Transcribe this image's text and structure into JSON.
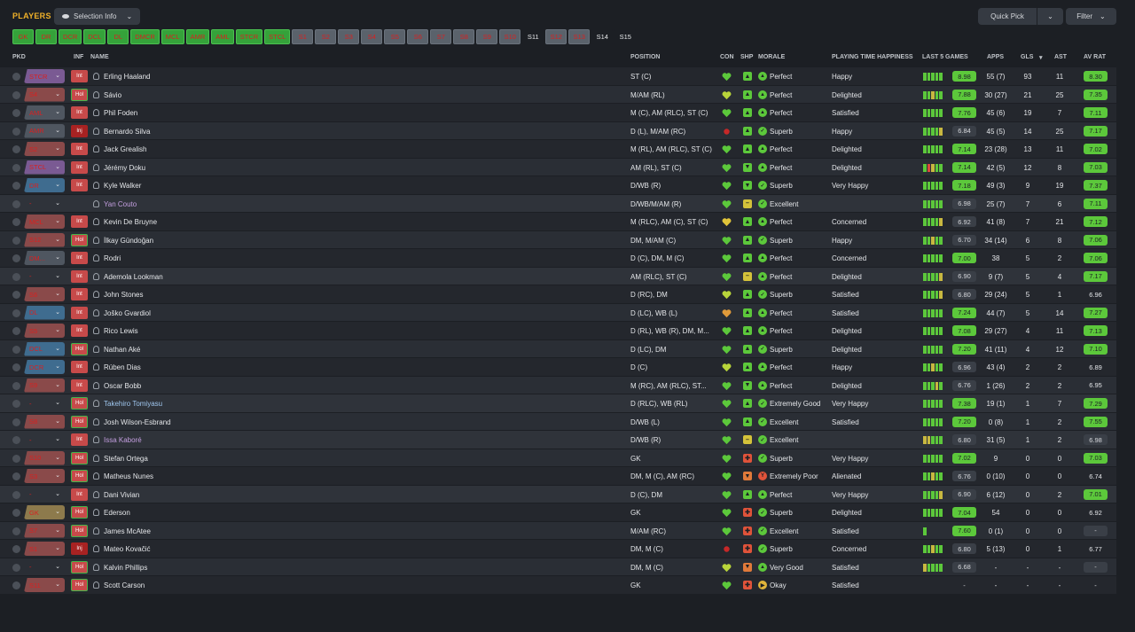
{
  "header": {
    "title": "PLAYERS",
    "selection_info": "Selection Info",
    "quick_pick": "Quick Pick",
    "filter": "Filter"
  },
  "chips": [
    {
      "label": "GK",
      "style": "green"
    },
    {
      "label": "DR",
      "style": "green"
    },
    {
      "label": "DCR",
      "style": "green"
    },
    {
      "label": "DCL",
      "style": "green"
    },
    {
      "label": "DL",
      "style": "green"
    },
    {
      "label": "DMCR",
      "style": "green"
    },
    {
      "label": "MCL",
      "style": "green"
    },
    {
      "label": "AMR",
      "style": "green"
    },
    {
      "label": "AML",
      "style": "green"
    },
    {
      "label": "STCR",
      "style": "green"
    },
    {
      "label": "STCL",
      "style": "green"
    },
    {
      "label": "S1",
      "style": "grey"
    },
    {
      "label": "S2",
      "style": "grey"
    },
    {
      "label": "S3",
      "style": "grey"
    },
    {
      "label": "S4",
      "style": "grey"
    },
    {
      "label": "S5",
      "style": "grey"
    },
    {
      "label": "S6",
      "style": "grey"
    },
    {
      "label": "S7",
      "style": "grey"
    },
    {
      "label": "S8",
      "style": "grey"
    },
    {
      "label": "S9",
      "style": "grey"
    },
    {
      "label": "S10",
      "style": "grey"
    },
    {
      "label": "S11",
      "style": "dark"
    },
    {
      "label": "S12",
      "style": "grey"
    },
    {
      "label": "S13",
      "style": "grey"
    },
    {
      "label": "S14",
      "style": "dark"
    },
    {
      "label": "S15",
      "style": "dark"
    }
  ],
  "columns": {
    "pkd": "PKD",
    "inf": "INF",
    "name": "NAME",
    "position": "POSITION",
    "con": "CON",
    "shp": "SHP",
    "morale": "MORALE",
    "pth": "PLAYING TIME HAPPINESS",
    "last5": "LAST 5 GAMES",
    "apps": "APPS",
    "gls": "GLS",
    "ast": "AST",
    "avrat": "AV RAT"
  },
  "colors": {
    "accent": "#f0b129",
    "good": "#5cc83b",
    "bad": "#d92020"
  },
  "players": [
    {
      "pkd": "STCR",
      "pkdStyle": "purple",
      "inf": "Int",
      "name": "Erling Haaland",
      "position": "ST (C)",
      "con": "green",
      "shp": "up",
      "moraleIcon": "up",
      "morale": "Perfect",
      "pth": "Happy",
      "bars": [
        "g",
        "g",
        "g",
        "g",
        "g"
      ],
      "last5": "8.98",
      "last5Style": "g",
      "apps": "55 (7)",
      "gls": "93",
      "ast": "11",
      "avr": "8.30",
      "avrStyle": "g"
    },
    {
      "pkd": "S4",
      "pkdStyle": "red",
      "inf": "Hol",
      "name": "Sávio",
      "position": "M/AM (RL)",
      "con": "yellowg",
      "shp": "up",
      "moraleIcon": "up",
      "morale": "Perfect",
      "pth": "Delighted",
      "bars": [
        "g",
        "g",
        "y",
        "g",
        "g"
      ],
      "last5": "7.88",
      "last5Style": "g",
      "apps": "30 (27)",
      "gls": "21",
      "ast": "25",
      "avr": "7.35",
      "avrStyle": "g"
    },
    {
      "pkd": "AML",
      "pkdStyle": "gray",
      "inf": "Int",
      "name": "Phil Foden",
      "position": "M (C), AM (RLC), ST (C)",
      "con": "green",
      "shp": "up",
      "moraleIcon": "up",
      "morale": "Perfect",
      "pth": "Satisfied",
      "bars": [
        "g",
        "g",
        "g",
        "g",
        "g"
      ],
      "last5": "7.76",
      "last5Style": "g",
      "apps": "45 (6)",
      "gls": "19",
      "ast": "7",
      "avr": "7.11",
      "avrStyle": "g"
    },
    {
      "pkd": "AMR",
      "pkdStyle": "gray",
      "inf": "Inj",
      "name": "Bernardo Silva",
      "position": "D (L), M/AM (RC)",
      "con": "red",
      "shp": "up",
      "moraleIcon": "sup",
      "morale": "Superb",
      "pth": "Happy",
      "bars": [
        "g",
        "g",
        "g",
        "g",
        "y"
      ],
      "last5": "6.84",
      "last5Style": "n",
      "apps": "45 (5)",
      "gls": "14",
      "ast": "25",
      "avr": "7.17",
      "avrStyle": "g"
    },
    {
      "pkd": "S2",
      "pkdStyle": "red",
      "inf": "Int",
      "name": "Jack Grealish",
      "position": "M (RL), AM (RLC), ST (C)",
      "con": "green",
      "shp": "up",
      "moraleIcon": "up",
      "morale": "Perfect",
      "pth": "Delighted",
      "bars": [
        "g",
        "g",
        "g",
        "g",
        "g"
      ],
      "last5": "7.14",
      "last5Style": "g",
      "apps": "23 (28)",
      "gls": "13",
      "ast": "11",
      "avr": "7.02",
      "avrStyle": "g"
    },
    {
      "pkd": "STCL",
      "pkdStyle": "purple",
      "inf": "Int",
      "name": "Jérémy Doku",
      "position": "AM (RL), ST (C)",
      "con": "green",
      "shp": "down",
      "moraleIcon": "up",
      "morale": "Perfect",
      "pth": "Delighted",
      "bars": [
        "g",
        "r",
        "y",
        "g",
        "g"
      ],
      "last5": "7.14",
      "last5Style": "g",
      "apps": "42 (5)",
      "gls": "12",
      "ast": "8",
      "avr": "7.03",
      "avrStyle": "g"
    },
    {
      "pkd": "DR",
      "pkdStyle": "blue",
      "inf": "Int",
      "name": "Kyle Walker",
      "position": "D/WB (R)",
      "con": "green",
      "shp": "down",
      "moraleIcon": "sup",
      "morale": "Superb",
      "pth": "Very Happy",
      "bars": [
        "g",
        "g",
        "g",
        "g",
        "g"
      ],
      "last5": "7.18",
      "last5Style": "g",
      "apps": "49 (3)",
      "gls": "9",
      "ast": "19",
      "avr": "7.37",
      "avrStyle": "g"
    },
    {
      "pkd": "-",
      "pkdStyle": "none",
      "inf": "",
      "name": "Yan Couto",
      "nameStyle": "link",
      "position": "D/WB/M/AM (R)",
      "con": "green",
      "shp": "mid",
      "moraleIcon": "sup",
      "morale": "Excellent",
      "pth": "",
      "bars": [
        "g",
        "g",
        "g",
        "g",
        "g"
      ],
      "last5": "6.98",
      "last5Style": "n",
      "apps": "25 (7)",
      "gls": "7",
      "ast": "6",
      "avr": "7.11",
      "avrStyle": "g"
    },
    {
      "pkd": "MCL",
      "pkdStyle": "red",
      "inf": "Int",
      "name": "Kevin De Bruyne",
      "position": "M (RLC), AM (C), ST (C)",
      "con": "yellow",
      "shp": "up",
      "moraleIcon": "up",
      "morale": "Perfect",
      "pth": "Concerned",
      "bars": [
        "g",
        "g",
        "g",
        "g",
        "y"
      ],
      "last5": "6.92",
      "last5Style": "n",
      "apps": "41 (8)",
      "gls": "7",
      "ast": "21",
      "avr": "7.12",
      "avrStyle": "g"
    },
    {
      "pkd": "S12",
      "pkdStyle": "red",
      "inf": "Hol",
      "name": "İlkay Gündoğan",
      "position": "DM, M/AM (C)",
      "con": "green",
      "shp": "up",
      "moraleIcon": "sup",
      "morale": "Superb",
      "pth": "Happy",
      "bars": [
        "g",
        "g",
        "y",
        "g",
        "g"
      ],
      "last5": "6.70",
      "last5Style": "n",
      "apps": "34 (14)",
      "gls": "6",
      "ast": "8",
      "avr": "7.06",
      "avrStyle": "g"
    },
    {
      "pkd": "DM...",
      "pkdStyle": "gray",
      "inf": "Int",
      "name": "Rodri",
      "position": "D (C), DM, M (C)",
      "con": "green",
      "shp": "up",
      "moraleIcon": "up",
      "morale": "Perfect",
      "pth": "Concerned",
      "bars": [
        "g",
        "g",
        "g",
        "g",
        "g"
      ],
      "last5": "7.00",
      "last5Style": "g",
      "apps": "38",
      "gls": "5",
      "ast": "2",
      "avr": "7.06",
      "avrStyle": "g"
    },
    {
      "pkd": "-",
      "pkdStyle": "none",
      "inf": "Int",
      "name": "Ademola Lookman",
      "position": "AM (RLC), ST (C)",
      "con": "green",
      "shp": "mid",
      "moraleIcon": "up",
      "morale": "Perfect",
      "pth": "Delighted",
      "bars": [
        "g",
        "g",
        "g",
        "g",
        "y"
      ],
      "last5": "6.90",
      "last5Style": "n",
      "apps": "9 (7)",
      "gls": "5",
      "ast": "4",
      "avr": "7.17",
      "avrStyle": "g"
    },
    {
      "pkd": "S6",
      "pkdStyle": "red",
      "inf": "Int",
      "name": "John Stones",
      "position": "D (RC), DM",
      "con": "yellowg",
      "shp": "up",
      "moraleIcon": "sup",
      "morale": "Superb",
      "pth": "Satisfied",
      "bars": [
        "g",
        "g",
        "g",
        "g",
        "y"
      ],
      "last5": "6.80",
      "last5Style": "n",
      "apps": "29 (24)",
      "gls": "5",
      "ast": "1",
      "avr": "6.96",
      "avrStyle": "plain"
    },
    {
      "pkd": "DL",
      "pkdStyle": "blue",
      "inf": "Int",
      "name": "Joško Gvardiol",
      "position": "D (LC), WB (L)",
      "con": "orange",
      "shp": "up",
      "moraleIcon": "up",
      "morale": "Perfect",
      "pth": "Satisfied",
      "bars": [
        "g",
        "g",
        "g",
        "g",
        "g"
      ],
      "last5": "7.24",
      "last5Style": "g",
      "apps": "44 (7)",
      "gls": "5",
      "ast": "14",
      "avr": "7.27",
      "avrStyle": "g"
    },
    {
      "pkd": "S5",
      "pkdStyle": "red",
      "inf": "Int",
      "name": "Rico Lewis",
      "position": "D (RL), WB (R), DM, M...",
      "con": "green",
      "shp": "up",
      "moraleIcon": "up",
      "morale": "Perfect",
      "pth": "Delighted",
      "bars": [
        "g",
        "g",
        "g",
        "g",
        "g"
      ],
      "last5": "7.08",
      "last5Style": "g",
      "apps": "29 (27)",
      "gls": "4",
      "ast": "11",
      "avr": "7.13",
      "avrStyle": "g"
    },
    {
      "pkd": "DCL",
      "pkdStyle": "blue",
      "inf": "Hol",
      "name": "Nathan Aké",
      "position": "D (LC), DM",
      "con": "green",
      "shp": "up",
      "moraleIcon": "sup",
      "morale": "Superb",
      "pth": "Delighted",
      "bars": [
        "g",
        "g",
        "g",
        "g",
        "g"
      ],
      "last5": "7.20",
      "last5Style": "g",
      "apps": "41 (11)",
      "gls": "4",
      "ast": "12",
      "avr": "7.10",
      "avrStyle": "g"
    },
    {
      "pkd": "DCR",
      "pkdStyle": "blue",
      "inf": "Int",
      "name": "Rúben Dias",
      "position": "D (C)",
      "con": "yellowg",
      "shp": "up",
      "moraleIcon": "up",
      "morale": "Perfect",
      "pth": "Happy",
      "bars": [
        "g",
        "g",
        "y",
        "g",
        "g"
      ],
      "last5": "6.96",
      "last5Style": "n",
      "apps": "43 (4)",
      "gls": "2",
      "ast": "2",
      "avr": "6.89",
      "avrStyle": "plain"
    },
    {
      "pkd": "S9",
      "pkdStyle": "red",
      "inf": "Int",
      "name": "Oscar Bobb",
      "position": "M (RC), AM (RLC), ST...",
      "con": "green",
      "shp": "down",
      "moraleIcon": "up",
      "morale": "Perfect",
      "pth": "Delighted",
      "bars": [
        "g",
        "g",
        "g",
        "y",
        "g"
      ],
      "last5": "6.76",
      "last5Style": "n",
      "apps": "1 (26)",
      "gls": "2",
      "ast": "2",
      "avr": "6.95",
      "avrStyle": "plain"
    },
    {
      "pkd": "-",
      "pkdStyle": "none",
      "inf": "Hol",
      "name": "Takehiro Tomiyasu",
      "nameStyle": "link2",
      "position": "D (RLC), WB (RL)",
      "con": "green",
      "shp": "up",
      "moraleIcon": "sup",
      "morale": "Extremely Good",
      "pth": "Very Happy",
      "bars": [
        "g",
        "g",
        "g",
        "g",
        "g"
      ],
      "last5": "7.38",
      "last5Style": "g",
      "apps": "19 (1)",
      "gls": "1",
      "ast": "7",
      "avr": "7.29",
      "avrStyle": "g"
    },
    {
      "pkd": "S8",
      "pkdStyle": "red",
      "inf": "Hol",
      "name": "Josh Wilson-Esbrand",
      "position": "D/WB (L)",
      "con": "green",
      "shp": "up",
      "moraleIcon": "sup",
      "morale": "Excellent",
      "pth": "Satisfied",
      "bars": [
        "g",
        "g",
        "g",
        "g",
        "g"
      ],
      "last5": "7.20",
      "last5Style": "g",
      "apps": "0 (8)",
      "gls": "1",
      "ast": "2",
      "avr": "7.55",
      "avrStyle": "g"
    },
    {
      "pkd": "-",
      "pkdStyle": "none",
      "inf": "Int",
      "name": "Issa Kaboré",
      "nameStyle": "link",
      "position": "D/WB (R)",
      "con": "green",
      "shp": "mid",
      "moraleIcon": "sup",
      "morale": "Excellent",
      "pth": "",
      "bars": [
        "y",
        "y",
        "g",
        "g",
        "g"
      ],
      "last5": "6.80",
      "last5Style": "n",
      "apps": "31 (5)",
      "gls": "1",
      "ast": "2",
      "avr": "6.98",
      "avrStyle": "n"
    },
    {
      "pkd": "S10",
      "pkdStyle": "red",
      "inf": "Hol",
      "name": "Stefan Ortega",
      "position": "GK",
      "con": "green",
      "shp": "red",
      "moraleIcon": "sup",
      "morale": "Superb",
      "pth": "Very Happy",
      "bars": [
        "g",
        "g",
        "g",
        "g",
        "g"
      ],
      "last5": "7.02",
      "last5Style": "g",
      "apps": "9",
      "gls": "0",
      "ast": "0",
      "avr": "7.03",
      "avrStyle": "g"
    },
    {
      "pkd": "S3",
      "pkdStyle": "red",
      "inf": "Hol",
      "name": "Matheus Nunes",
      "position": "DM, M (C), AM (RC)",
      "con": "green",
      "shp": "orange",
      "moraleIcon": "bad",
      "morale": "Extremely Poor",
      "pth": "Alienated",
      "bars": [
        "g",
        "g",
        "y",
        "g",
        "g"
      ],
      "last5": "6.76",
      "last5Style": "n",
      "apps": "0 (10)",
      "gls": "0",
      "ast": "0",
      "avr": "6.74",
      "avrStyle": "plain"
    },
    {
      "pkd": "-",
      "pkdStyle": "none",
      "inf": "Int",
      "name": "Dani Vivian",
      "position": "D (C), DM",
      "con": "green",
      "shp": "up",
      "moraleIcon": "up",
      "morale": "Perfect",
      "pth": "Very Happy",
      "bars": [
        "g",
        "g",
        "g",
        "g",
        "y"
      ],
      "last5": "6.90",
      "last5Style": "n",
      "apps": "6 (12)",
      "gls": "0",
      "ast": "2",
      "avr": "7.01",
      "avrStyle": "g"
    },
    {
      "pkd": "GK",
      "pkdStyle": "olive",
      "inf": "Hol",
      "name": "Ederson",
      "position": "GK",
      "con": "green",
      "shp": "red",
      "moraleIcon": "sup",
      "morale": "Superb",
      "pth": "Delighted",
      "bars": [
        "g",
        "g",
        "g",
        "g",
        "g"
      ],
      "last5": "7.04",
      "last5Style": "g",
      "apps": "54",
      "gls": "0",
      "ast": "0",
      "avr": "6.92",
      "avrStyle": "plain"
    },
    {
      "pkd": "S7",
      "pkdStyle": "red",
      "inf": "Hol",
      "name": "James McAtee",
      "position": "M/AM (RC)",
      "con": "green",
      "shp": "red",
      "moraleIcon": "sup",
      "morale": "Excellent",
      "pth": "Satisfied",
      "bars": [
        "g"
      ],
      "last5": "7.60",
      "last5Style": "g",
      "apps": "0 (1)",
      "gls": "0",
      "ast": "0",
      "avr": "-",
      "avrStyle": "n"
    },
    {
      "pkd": "S1",
      "pkdStyle": "red",
      "inf": "Inj",
      "name": "Mateo Kovačić",
      "position": "DM, M (C)",
      "con": "red",
      "shp": "red",
      "moraleIcon": "sup",
      "morale": "Superb",
      "pth": "Concerned",
      "bars": [
        "g",
        "g",
        "y",
        "g",
        "g"
      ],
      "last5": "6.80",
      "last5Style": "n",
      "apps": "5 (13)",
      "gls": "0",
      "ast": "1",
      "avr": "6.77",
      "avrStyle": "plain"
    },
    {
      "pkd": "-",
      "pkdStyle": "none",
      "inf": "Hol",
      "name": "Kalvin Phillips",
      "position": "DM, M (C)",
      "con": "yellowg",
      "shp": "orange",
      "moraleIcon": "up",
      "morale": "Very Good",
      "pth": "Satisfied",
      "bars": [
        "y",
        "g",
        "g",
        "g",
        "g"
      ],
      "last5": "6.68",
      "last5Style": "n",
      "apps": "-",
      "gls": "-",
      "ast": "-",
      "avr": "-",
      "avrStyle": "n"
    },
    {
      "pkd": "S11",
      "pkdStyle": "red",
      "inf": "Hol",
      "name": "Scott Carson",
      "position": "GK",
      "con": "green",
      "shp": "red",
      "moraleIcon": "ok",
      "morale": "Okay",
      "pth": "Satisfied",
      "bars": [],
      "last5": "-",
      "last5Style": "plainn",
      "apps": "-",
      "gls": "-",
      "ast": "-",
      "avr": "-",
      "avrStyle": "plain"
    }
  ]
}
